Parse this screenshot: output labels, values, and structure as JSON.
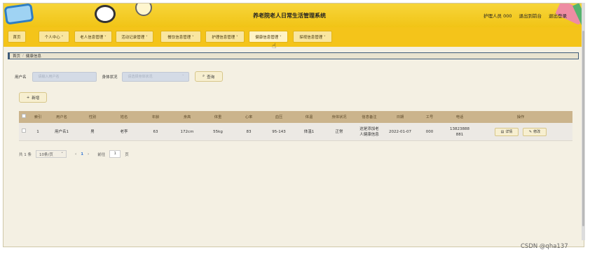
{
  "header": {
    "title": "养老院老人日常生活管理系统",
    "user_label": "护理人员 000",
    "back_label": "退出到前台",
    "logout_label": "退出登录"
  },
  "nav": {
    "items": [
      {
        "label": "首页"
      },
      {
        "label": "个人中心 ˅"
      },
      {
        "label": "老人信息管理 ˅"
      },
      {
        "label": "活动记录管理 ˅"
      },
      {
        "label": "餐饮信息管理 ˅"
      },
      {
        "label": "护理信息管理 ˅"
      },
      {
        "label": "健康信息管理 ˅"
      },
      {
        "label": "探视信息管理 ˅"
      }
    ]
  },
  "breadcrumb": {
    "home": "首页",
    "sep": "/",
    "current": "健康信息"
  },
  "search": {
    "username_label": "用户名",
    "username_placeholder": "请输入用户名",
    "health_label": "身体状况",
    "health_placeholder": "请选择身体状况",
    "query_label": "查询"
  },
  "add_label": "新增",
  "table": {
    "headers": [
      "索引",
      "用户名",
      "性别",
      "姓名",
      "年龄",
      "身高",
      "体重",
      "心率",
      "血压",
      "体温",
      "身体状况",
      "信息备注",
      "日期",
      "工号",
      "电话",
      "操作"
    ],
    "rows": [
      [
        "1",
        "用户名1",
        "男",
        "老李",
        "63",
        "172cm",
        "55kg",
        "83",
        "95-143",
        "体温1",
        "正常",
        "这是添加老人健康信息",
        "2022-01-07",
        "000",
        "13823888881"
      ]
    ],
    "detail_label": "详情",
    "edit_label": "修改"
  },
  "pager": {
    "total": "共 1 条",
    "page_size": "10条/页",
    "prev": "‹",
    "current": "1",
    "next": "›",
    "goto_label": "前往",
    "goto_value": "1",
    "page_suffix": "页"
  },
  "watermark": "CSDN @qha137"
}
